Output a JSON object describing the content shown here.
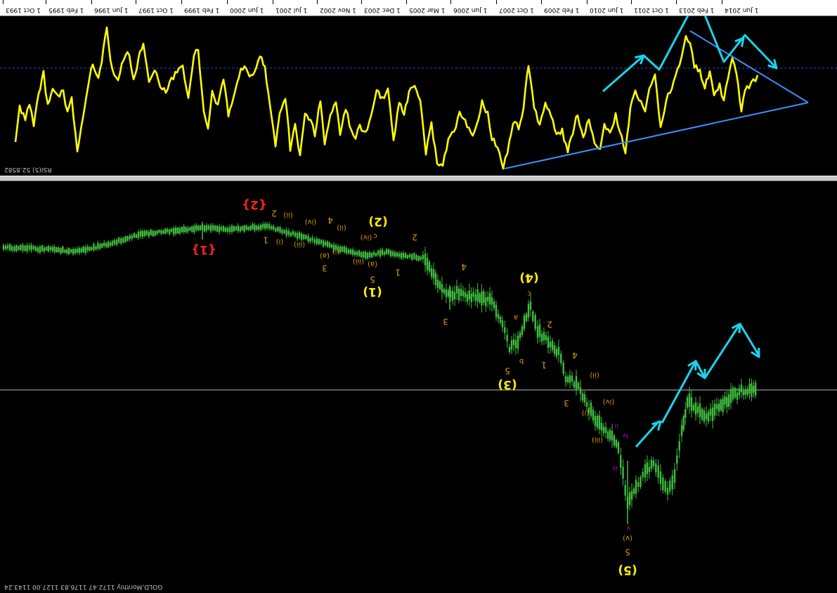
{
  "timeline": {
    "labels": [
      "1 Oct 1993",
      "1 Feb 1995",
      "1 Jun 1996",
      "1 Oct 1997",
      "1 Feb 1999",
      "1 Jun 2000",
      "1 Jul 2001",
      "1 Nov 2002",
      "1 Dec 2003",
      "1 Mar 2005",
      "1 Jun 2006",
      "1 Oct 2007",
      "1 Feb 2009",
      "1 Jun 2010",
      "1 Oct 2011",
      "1 Feb 2013",
      "1 Jun 2014"
    ]
  },
  "rsi_panel": {
    "label": "RSI(5) 52.8582",
    "colors": {
      "line": "#ffff00",
      "trend": "#3a8fff",
      "arrow": "#19d4ee",
      "level": "#3a3aff"
    }
  },
  "price_panel": {
    "label": "GOLD,Monthly  1172.47 1176.83 1127.00 1143.24",
    "colors": {
      "candles": "#3fbf3f",
      "wave_red": "#ff2020",
      "wave_yellow": "#ffee00",
      "wave_orange": "#d9a000",
      "wave_magenta": "#d000d0",
      "arrow": "#19d4ee",
      "hline": "#bdbdbd"
    },
    "wave_labels": {
      "red_1": "{1}",
      "red_2": "{2}",
      "y_1": "(1)",
      "y_2": "(2)",
      "y_3": "(3)",
      "y_4": "(4)",
      "y_5": "(5)",
      "o_i": "(i)",
      "o_ii": "(ii)",
      "o_iii": "(iii)",
      "o_iv": "(iv)",
      "o_v": "(v)",
      "o_a": "(a)",
      "o_b": "(b)",
      "o_c": "(c)",
      "n_1": "1",
      "n_2": "2",
      "n_3": "3",
      "n_4": "4",
      "n_5": "5",
      "l_a": "a",
      "l_b": "b",
      "l_c": "c",
      "m_i": "i",
      "m_ii": "ii",
      "m_iii": "iii",
      "m_iv": "iv",
      "m_v": "v"
    }
  }
}
